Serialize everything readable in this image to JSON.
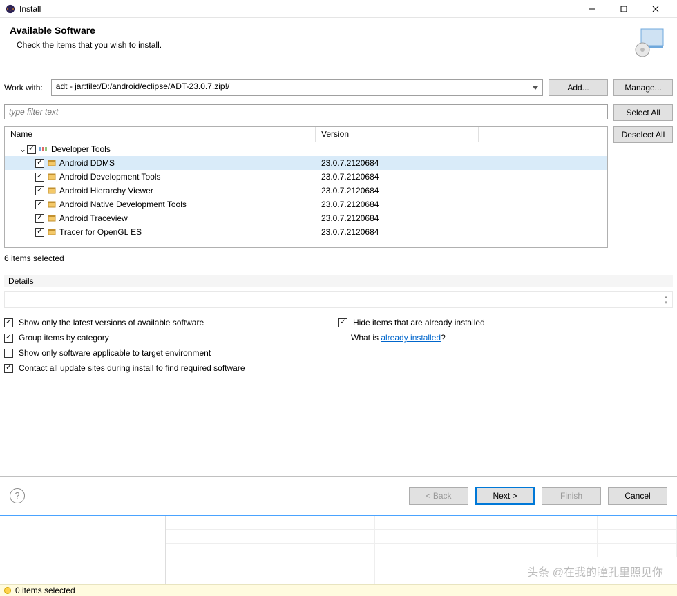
{
  "window": {
    "title": "Install"
  },
  "header": {
    "title": "Available Software",
    "subtitle": "Check the items that you wish to install."
  },
  "workwith": {
    "label": "Work with:",
    "value": "adt - jar:file:/D:/android/eclipse/ADT-23.0.7.zip!/",
    "add_btn": "Add...",
    "manage_btn": "Manage..."
  },
  "filter": {
    "placeholder": "type filter text"
  },
  "side": {
    "select_all": "Select All",
    "deselect_all": "Deselect All"
  },
  "columns": {
    "name": "Name",
    "version": "Version"
  },
  "tree": {
    "group": {
      "label": "Developer Tools",
      "expanded": true,
      "checked": true
    },
    "items": [
      {
        "label": "Android DDMS",
        "version": "23.0.7.2120684",
        "checked": true,
        "selected": true
      },
      {
        "label": "Android Development Tools",
        "version": "23.0.7.2120684",
        "checked": true
      },
      {
        "label": "Android Hierarchy Viewer",
        "version": "23.0.7.2120684",
        "checked": true
      },
      {
        "label": "Android Native Development Tools",
        "version": "23.0.7.2120684",
        "checked": true
      },
      {
        "label": "Android Traceview",
        "version": "23.0.7.2120684",
        "checked": true
      },
      {
        "label": "Tracer for OpenGL ES",
        "version": "23.0.7.2120684",
        "checked": true
      }
    ]
  },
  "selection_count": "6 items selected",
  "details": {
    "label": "Details"
  },
  "options": {
    "latest": "Show only the latest versions of available software",
    "hide_installed": "Hide items that are already installed",
    "group_cat": "Group items by category",
    "whatis_pre": "What is ",
    "whatis_link": "already installed",
    "whatis_post": "?",
    "applicable": "Show only software applicable to target environment",
    "contact": "Contact all update sites during install to find required software"
  },
  "footer": {
    "back": "< Back",
    "next": "Next >",
    "finish": "Finish",
    "cancel": "Cancel"
  },
  "status": {
    "text": "0 items selected"
  },
  "watermark": "头条 @在我的瞳孔里照见你"
}
